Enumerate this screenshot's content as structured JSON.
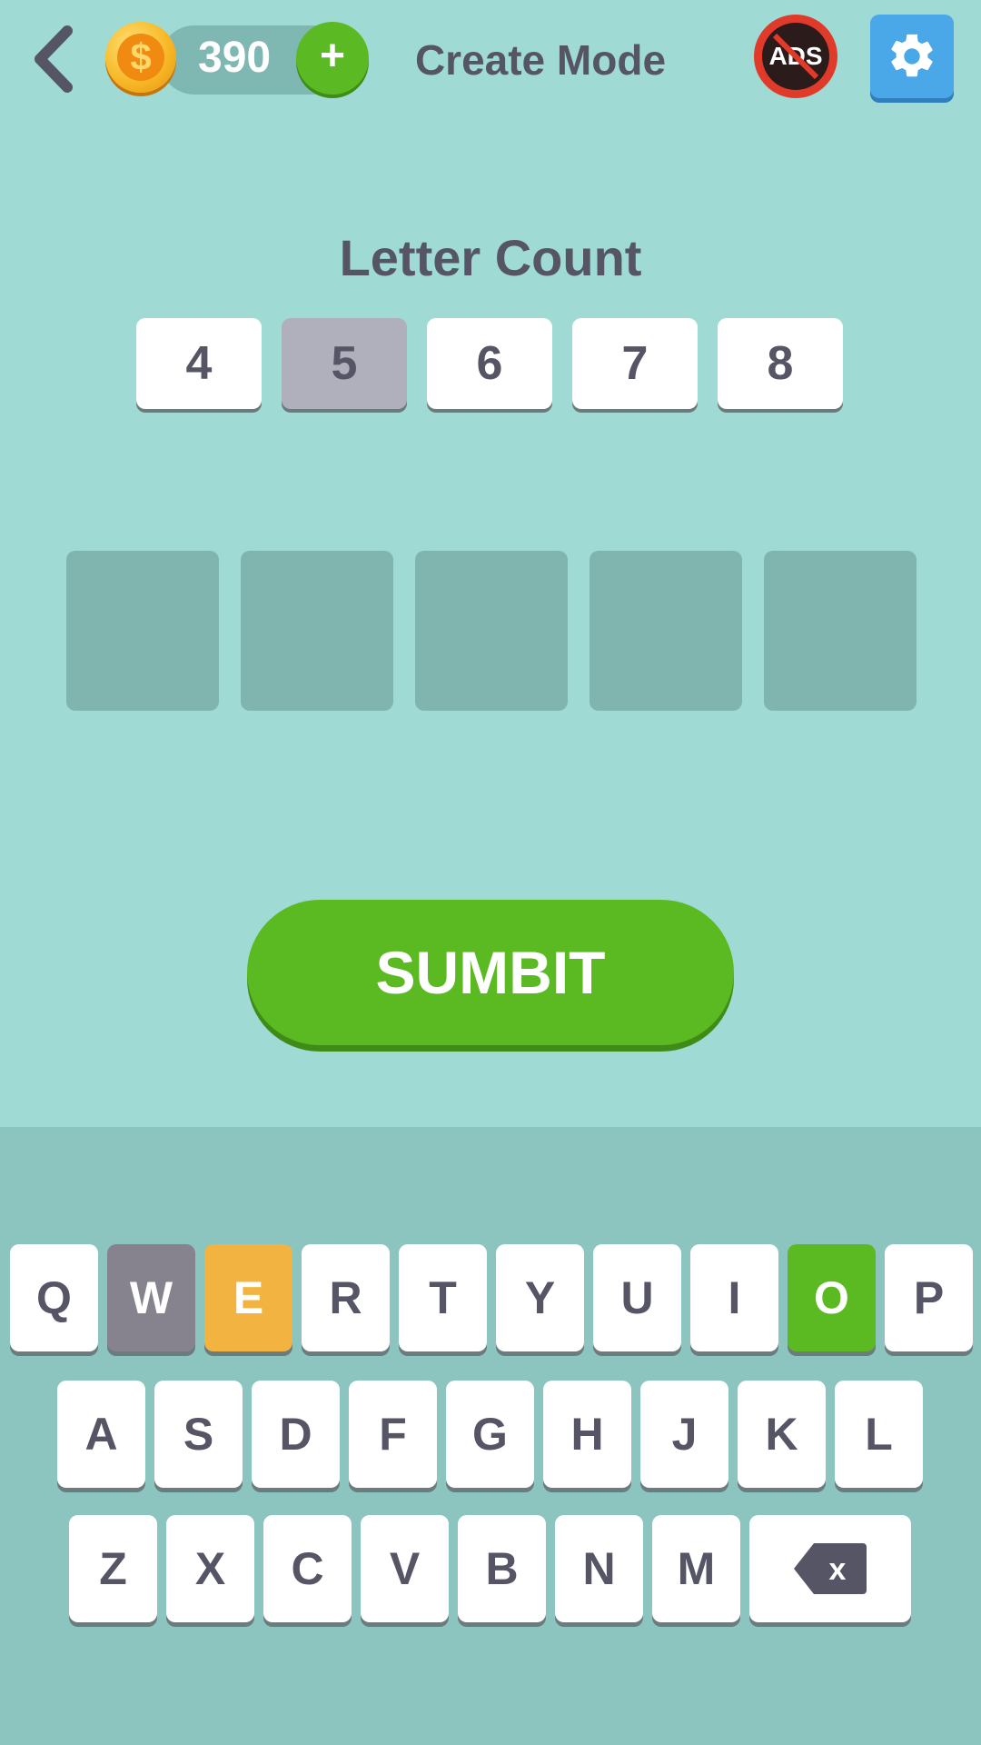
{
  "header": {
    "title": "Create Mode",
    "coins": "390",
    "add_coins_label": "+",
    "ads_label": "ADS",
    "coin_symbol": "$",
    "back_icon": "chevron-left-icon",
    "settings_icon": "gear-icon"
  },
  "letter_count": {
    "label": "Letter Count",
    "options": [
      "4",
      "5",
      "6",
      "7",
      "8"
    ],
    "selected": "5"
  },
  "word_slots": {
    "count": 5,
    "letters": [
      "",
      "",
      "",
      "",
      ""
    ]
  },
  "submit": {
    "label": "SUMBIT"
  },
  "keyboard": {
    "row1": [
      "Q",
      "W",
      "E",
      "R",
      "T",
      "Y",
      "U",
      "I",
      "O",
      "P"
    ],
    "row2": [
      "A",
      "S",
      "D",
      "F",
      "G",
      "H",
      "J",
      "K",
      "L"
    ],
    "row3": [
      "Z",
      "X",
      "C",
      "V",
      "B",
      "N",
      "M"
    ],
    "delete_icon": "backspace-icon",
    "delete_label": "x",
    "key_states": {
      "W": "absent",
      "E": "present",
      "O": "correct"
    }
  },
  "colors": {
    "background": "#9fdbd4",
    "keyboard_bg": "#8cc5bf",
    "slot": "#80b4af",
    "green": "#5bb922",
    "yellow": "#f2b340",
    "gray": "#86838f",
    "text": "#555566",
    "settings_blue": "#4aa7e8",
    "ads_red": "#e03a2a"
  }
}
